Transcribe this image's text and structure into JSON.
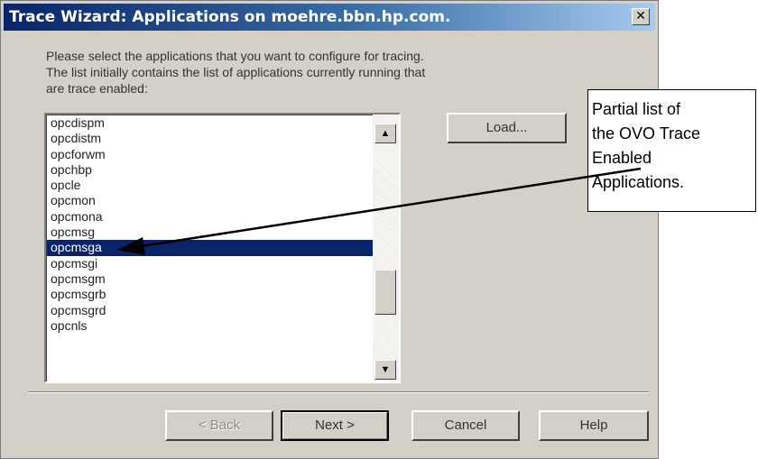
{
  "window": {
    "title": "Trace Wizard: Applications on moehre.bbn.hp.com.",
    "close_glyph": "✕"
  },
  "instructions": "Please select the applications that you want to configure for tracing.\nThe list initially contains the list of applications currently running that\nare trace enabled:",
  "app_list": {
    "items": [
      "opcdispm",
      "opcdistm",
      "opcforwm",
      "opchbp",
      "opcle",
      "opcmon",
      "opcmona",
      "opcmsg",
      "opcmsga",
      "opcmsgi",
      "opcmsgm",
      "opcmsgrb",
      "opcmsgrd",
      "opcnls"
    ],
    "selected": "opcmsga",
    "scroll_up_glyph": "▲",
    "scroll_down_glyph": "▼"
  },
  "buttons": {
    "load": "Load...",
    "back": "< Back",
    "next": "Next >",
    "cancel": "Cancel",
    "help": "Help"
  },
  "callout": {
    "text": "Partial list of\nthe OVO Trace\nEnabled\nApplications."
  },
  "colors": {
    "dialog_bg": "#d4d0c8",
    "title_start": "#0a246a",
    "title_end": "#a6caf0",
    "selection": "#0a246a"
  }
}
